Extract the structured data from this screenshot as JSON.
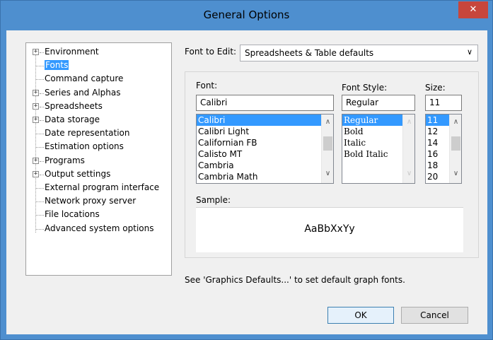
{
  "window": {
    "title": "General Options",
    "close_glyph": "✕"
  },
  "tree": {
    "items": [
      {
        "label": "Environment",
        "expandable": true,
        "selected": false
      },
      {
        "label": "Fonts",
        "expandable": false,
        "selected": true
      },
      {
        "label": "Command capture",
        "expandable": false,
        "selected": false
      },
      {
        "label": "Series and Alphas",
        "expandable": true,
        "selected": false
      },
      {
        "label": "Spreadsheets",
        "expandable": true,
        "selected": false
      },
      {
        "label": "Data storage",
        "expandable": true,
        "selected": false
      },
      {
        "label": "Date representation",
        "expandable": false,
        "selected": false
      },
      {
        "label": "Estimation options",
        "expandable": false,
        "selected": false
      },
      {
        "label": "Programs",
        "expandable": true,
        "selected": false
      },
      {
        "label": "Output settings",
        "expandable": true,
        "selected": false
      },
      {
        "label": "External program interface",
        "expandable": false,
        "selected": false
      },
      {
        "label": "Network proxy server",
        "expandable": false,
        "selected": false
      },
      {
        "label": "File locations",
        "expandable": false,
        "selected": false
      },
      {
        "label": "Advanced system options",
        "expandable": false,
        "selected": false
      }
    ],
    "expand_glyph": "+"
  },
  "font_to_edit": {
    "label": "Font to Edit:",
    "value": "Spreadsheets & Table defaults",
    "chevron": "∨"
  },
  "font": {
    "label": "Font:",
    "value": "Calibri",
    "list": [
      "Calibri",
      "Calibri Light",
      "Californian FB",
      "Calisto MT",
      "Cambria",
      "Cambria Math"
    ],
    "selected_index": 0
  },
  "font_style": {
    "label": "Font Style:",
    "value": "Regular",
    "list": [
      "Regular",
      "Bold",
      "Italic",
      "Bold Italic"
    ],
    "selected_index": 0
  },
  "size": {
    "label": "Size:",
    "value": "11",
    "list": [
      "11",
      "12",
      "14",
      "16",
      "18",
      "20"
    ],
    "selected_index": 0
  },
  "scroll": {
    "up": "∧",
    "down": "∨"
  },
  "sample": {
    "label": "Sample:",
    "text": "AaBbXxYy"
  },
  "hint": "See 'Graphics Defaults...' to set default graph fonts.",
  "buttons": {
    "ok": "OK",
    "cancel": "Cancel"
  }
}
